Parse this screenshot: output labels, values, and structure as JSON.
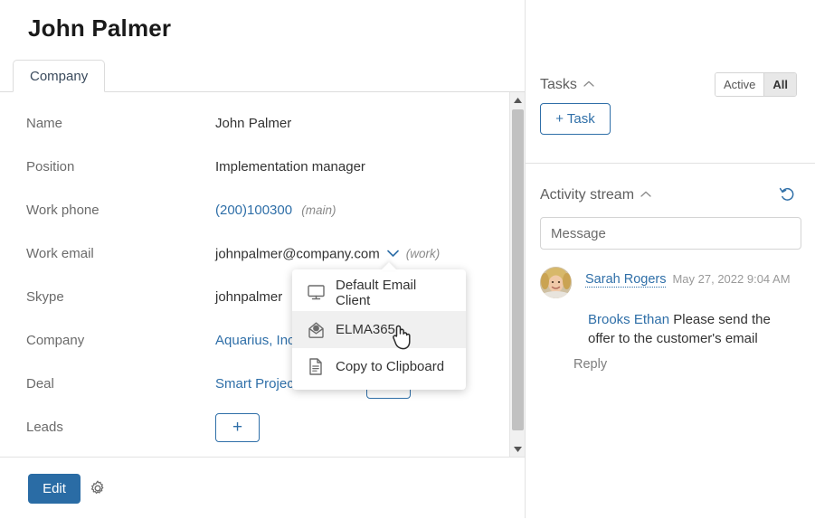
{
  "header": {
    "title": "John Palmer",
    "close_label": "×"
  },
  "tabs": [
    {
      "label": "Company",
      "active": true
    }
  ],
  "form": {
    "rows": [
      {
        "label": "Name",
        "value": "John Palmer",
        "kind": "text"
      },
      {
        "label": "Position",
        "value": "Implementation manager",
        "kind": "text"
      },
      {
        "label": "Work phone",
        "value": "(200)100300",
        "tag": "(main)",
        "kind": "link"
      },
      {
        "label": "Work email",
        "value": "johnpalmer@company.com",
        "tag": "(work)",
        "kind": "text-with-chevron"
      },
      {
        "label": "Skype",
        "value": "johnpalmer",
        "kind": "text"
      },
      {
        "label": "Company",
        "value": "Aquarius, Inc.",
        "kind": "link"
      },
      {
        "label": "Deal",
        "value": "Smart Project",
        "kind": "link"
      },
      {
        "label": "Leads",
        "value": "",
        "kind": "add-button"
      }
    ],
    "add_button_label": "+"
  },
  "email_menu": {
    "items": [
      {
        "label": "Default Email Client",
        "icon": "monitor-icon",
        "hover": false
      },
      {
        "label": "ELMA365",
        "icon": "envelope-icon",
        "hover": true
      },
      {
        "label": "Copy to Clipboard",
        "icon": "document-icon",
        "hover": false
      }
    ]
  },
  "footer": {
    "edit_label": "Edit",
    "settings_icon": "gear-icon"
  },
  "right_panel": {
    "tasks": {
      "title": "Tasks",
      "filter_options": [
        "Active",
        "All"
      ],
      "filter_selected": "All",
      "add_task_label": "+ Task"
    },
    "activity": {
      "title": "Activity stream",
      "refresh_icon": "refresh-icon",
      "message_placeholder": "Message",
      "posts": [
        {
          "author": "Sarah Rogers",
          "timestamp": "May 27, 2022 9:04 AM",
          "mention": "Brooks Ethan",
          "text": " Please send the offer to the customer's email",
          "reply_label": "Reply"
        }
      ]
    }
  },
  "colors": {
    "accent": "#2f6fa8",
    "primary_button": "#2a6ca5",
    "text": "#333333",
    "muted": "#6b6b6b",
    "border": "#dcdcdc"
  }
}
